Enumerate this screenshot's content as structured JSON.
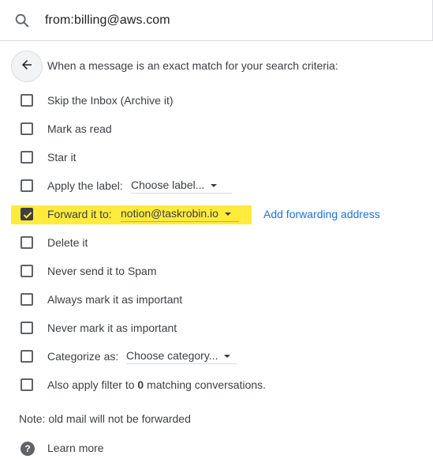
{
  "search": {
    "query": "from:billing@aws.com",
    "icon": "search-icon"
  },
  "header": {
    "back_icon": "arrow-back-icon",
    "text": "When a message is an exact match for your search criteria:"
  },
  "options": [
    {
      "label": "Skip the Inbox (Archive it)",
      "checked": false
    },
    {
      "label": "Mark as read",
      "checked": false
    },
    {
      "label": "Star it",
      "checked": false
    },
    {
      "label": "Apply the label:",
      "checked": false,
      "dropdown": "Choose label..."
    },
    {
      "label": "Forward it to:",
      "checked": true,
      "dropdown": "notion@taskrobin.io",
      "link": "Add forwarding address",
      "highlight_color": "#ffeb3b"
    },
    {
      "label": "Delete it",
      "checked": false
    },
    {
      "label": "Never send it to Spam",
      "checked": false
    },
    {
      "label": "Always mark it as important",
      "checked": false
    },
    {
      "label": "Never mark it as important",
      "checked": false
    },
    {
      "label": "Categorize as:",
      "checked": false,
      "dropdown": "Choose category..."
    },
    {
      "label_prefix": "Also apply filter to",
      "count": "0",
      "label_suffix": "matching conversations.",
      "checked": false
    }
  ],
  "note": "Note: old mail will not be forwarded",
  "learn_more": {
    "icon": "help-circle-icon",
    "label": "Learn more"
  },
  "colors": {
    "highlight": "#ffeb3b",
    "link": "#1a73e8",
    "text": "#3c4043"
  }
}
